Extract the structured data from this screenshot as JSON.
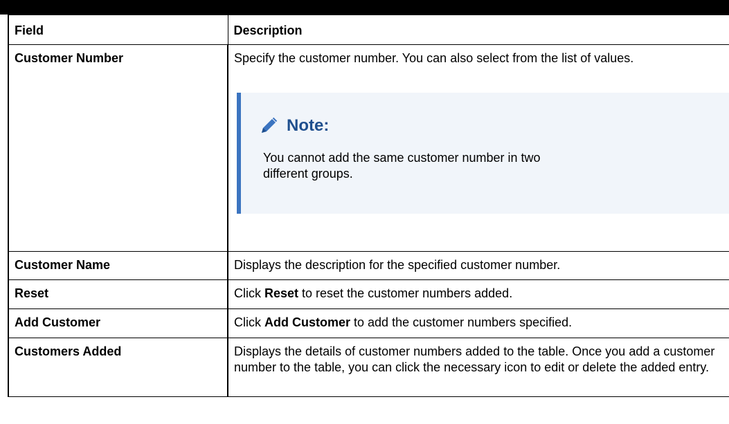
{
  "table": {
    "headers": [
      "Field",
      "Description"
    ],
    "rows": [
      {
        "field": "Customer Number",
        "description": "Specify the customer number. You can also select from the list of values.",
        "note": {
          "title": "Note:",
          "text": "You cannot add the same customer number in two different groups.",
          "icon": "pencil-icon"
        }
      },
      {
        "field": "Customer Name",
        "description": "Displays the description for the specified customer number."
      },
      {
        "field": "Reset",
        "desc_prefix": "Click ",
        "desc_bold": "Reset",
        "desc_suffix": " to reset the customer numbers added."
      },
      {
        "field": "Add Customer",
        "desc_prefix": "Click ",
        "desc_bold": "Add Customer",
        "desc_suffix": " to add the customer numbers specified."
      },
      {
        "field": "Customers Added",
        "description": "Displays the details of customer numbers added to the table. Once you add a customer number to the table, you can click the necessary icon to edit or delete the added entry."
      }
    ]
  },
  "colors": {
    "note_bar": "#3b74c0",
    "note_bg": "#f1f5fa",
    "note_title": "#1f4f8e"
  }
}
